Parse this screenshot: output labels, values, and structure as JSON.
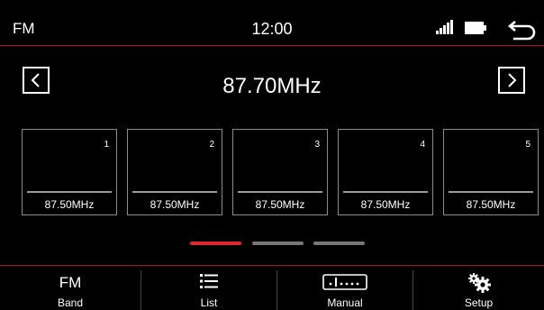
{
  "status": {
    "band": "FM",
    "time": "12:00"
  },
  "tuner": {
    "frequency": "87.70MHz"
  },
  "presets": [
    {
      "number": "1",
      "frequency": "87.50MHz"
    },
    {
      "number": "2",
      "frequency": "87.50MHz"
    },
    {
      "number": "3",
      "frequency": "87.50MHz"
    },
    {
      "number": "4",
      "frequency": "87.50MHz"
    },
    {
      "number": "5",
      "frequency": "87.50MHz"
    }
  ],
  "pages": {
    "count": 3,
    "active": 1
  },
  "bottom_bar": {
    "band_icon_text": "FM",
    "band_label": "Band",
    "list_label": "List",
    "manual_label": "Manual",
    "setup_label": "Setup"
  },
  "colors": {
    "accent": "#e0262e",
    "divider": "#b3121c",
    "background": "#000000"
  },
  "icons": {
    "status": [
      "signal-icon",
      "battery-icon",
      "back-arrow-icon"
    ],
    "navigation": [
      "chevron-left-icon",
      "chevron-right-icon"
    ],
    "tabs": [
      "list-icon",
      "manual-tuning-icon",
      "gears-icon"
    ]
  }
}
